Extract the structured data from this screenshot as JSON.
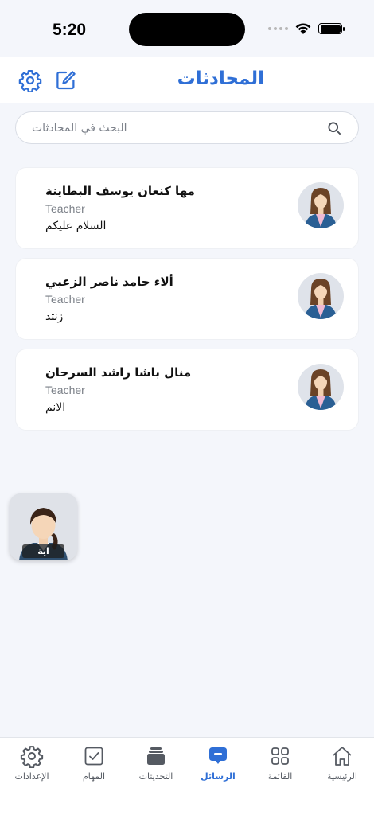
{
  "status_bar": {
    "time": "5:20"
  },
  "header": {
    "title": "المحادثات",
    "settings_icon": "gear-icon",
    "compose_icon": "compose-icon"
  },
  "search": {
    "placeholder": "البحث في المحادثات",
    "value": ""
  },
  "conversations": [
    {
      "name": "مها كنعان يوسف البطاينة",
      "role": "Teacher",
      "last_message": "السلام عليكم"
    },
    {
      "name": "ألاء حامد ناصر الزعبي",
      "role": "Teacher",
      "last_message": "زنتد"
    },
    {
      "name": "منال باشا راشد السرحان",
      "role": "Teacher",
      "last_message": "الانم"
    }
  ],
  "floating_bubble": {
    "label": "اية"
  },
  "tabs": [
    {
      "label": "الرئيسية",
      "icon": "home-icon"
    },
    {
      "label": "القائمة",
      "icon": "grid-icon"
    },
    {
      "label": "الرسائل",
      "icon": "chat-icon",
      "active": true
    },
    {
      "label": "التحديثات",
      "icon": "stack-icon"
    },
    {
      "label": "المهام",
      "icon": "checkbox-icon"
    },
    {
      "label": "الإعدادات",
      "icon": "gear-icon"
    }
  ],
  "colors": {
    "accent": "#2f6fd6",
    "background": "#f4f6fb"
  }
}
